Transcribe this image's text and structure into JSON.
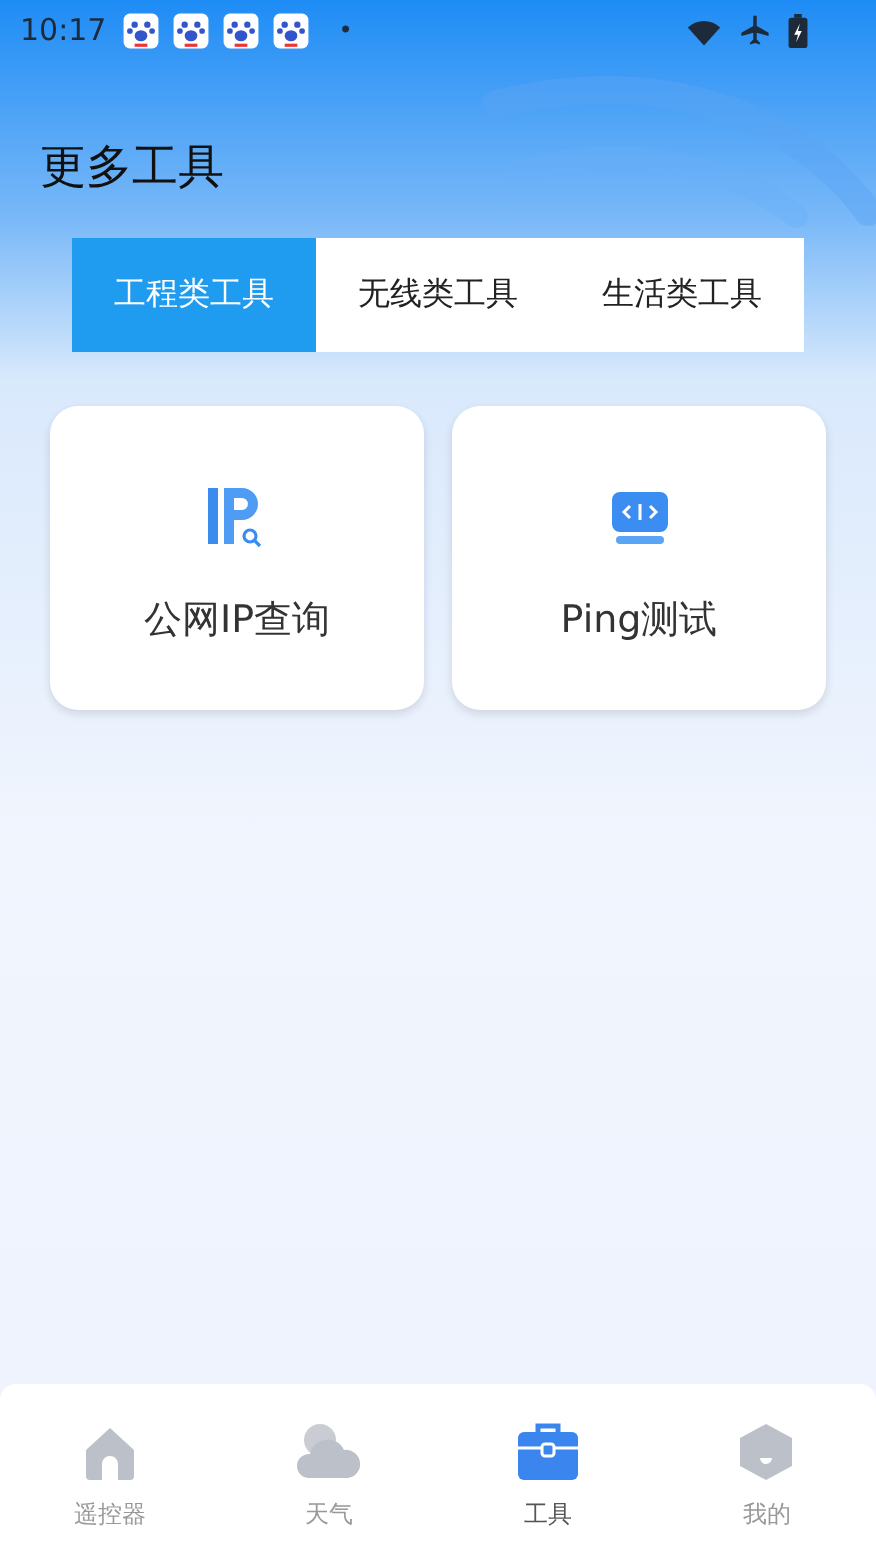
{
  "status_bar": {
    "time": "10:17",
    "notifications": [
      {
        "kind": "paw"
      },
      {
        "kind": "paw"
      },
      {
        "kind": "paw"
      },
      {
        "kind": "paw"
      }
    ],
    "more": "•"
  },
  "title": "更多工具",
  "tabs": [
    {
      "label": "工程类工具",
      "selected": true
    },
    {
      "label": "无线类工具",
      "selected": false
    },
    {
      "label": "生活类工具",
      "selected": false
    }
  ],
  "tools": [
    {
      "label": "公网IP查询",
      "kind": "ip"
    },
    {
      "label": "Ping测试",
      "kind": "ping"
    }
  ],
  "nav": [
    {
      "label": "遥控器",
      "kind": "home",
      "selected": false
    },
    {
      "label": "天气",
      "kind": "cloud",
      "selected": false
    },
    {
      "label": "工具",
      "kind": "toolbox",
      "selected": true
    },
    {
      "label": "我的",
      "kind": "profile",
      "selected": false
    }
  ]
}
